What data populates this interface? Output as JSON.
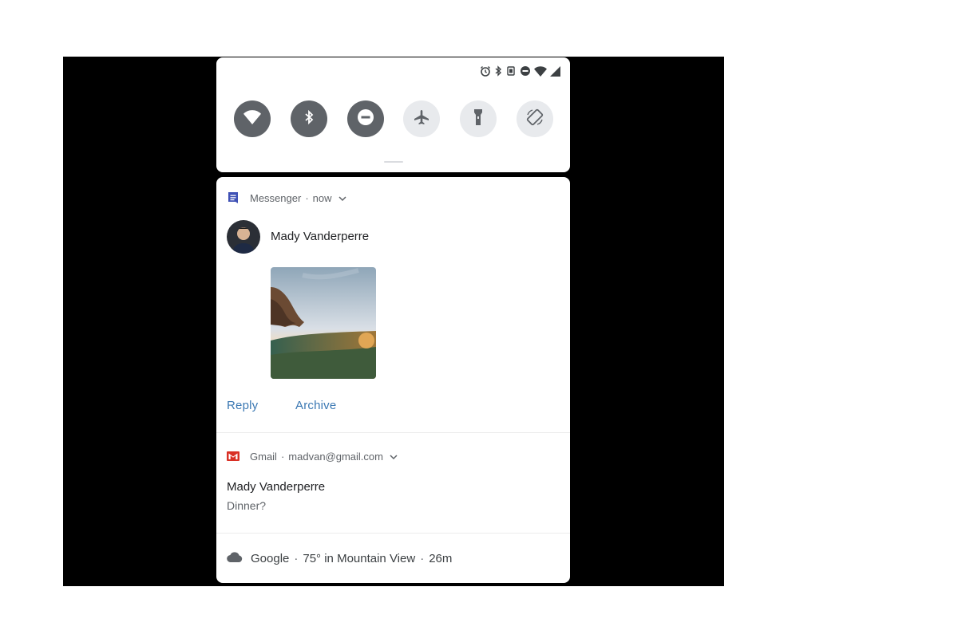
{
  "quick_settings": {
    "status_icons": [
      "alarm-icon",
      "bluetooth-icon",
      "vibrate-icon",
      "do-not-disturb-icon",
      "wifi-icon",
      "signal-icon"
    ],
    "tiles": [
      {
        "icon": "wifi-icon",
        "state": "on"
      },
      {
        "icon": "bluetooth-icon",
        "state": "on"
      },
      {
        "icon": "do-not-disturb-icon",
        "state": "on"
      },
      {
        "icon": "airplane-mode-icon",
        "state": "off"
      },
      {
        "icon": "flashlight-icon",
        "state": "off"
      },
      {
        "icon": "auto-rotate-icon",
        "state": "off"
      }
    ]
  },
  "notifications": {
    "messenger": {
      "app_name": "Messenger",
      "separator": "·",
      "time": "now",
      "sender": "Mady Vanderperre",
      "actions": {
        "reply": "Reply",
        "archive": "Archive"
      }
    },
    "gmail": {
      "app_name": "Gmail",
      "separator": "·",
      "account": "madvan@gmail.com",
      "sender": "Mady Vanderperre",
      "message": "Dinner?"
    },
    "weather": {
      "app_name": "Google",
      "separator": "·",
      "summary": "75° in Mountain View",
      "time": "26m"
    }
  },
  "colors": {
    "screen_background": "#000000",
    "panel_background": "#ffffff",
    "tile_active": "#5f6368",
    "tile_inactive": "#e8eaed",
    "action_text": "#3b78b3",
    "messenger_icon": "#3f51b5",
    "gmail_icon": "#d93025"
  }
}
